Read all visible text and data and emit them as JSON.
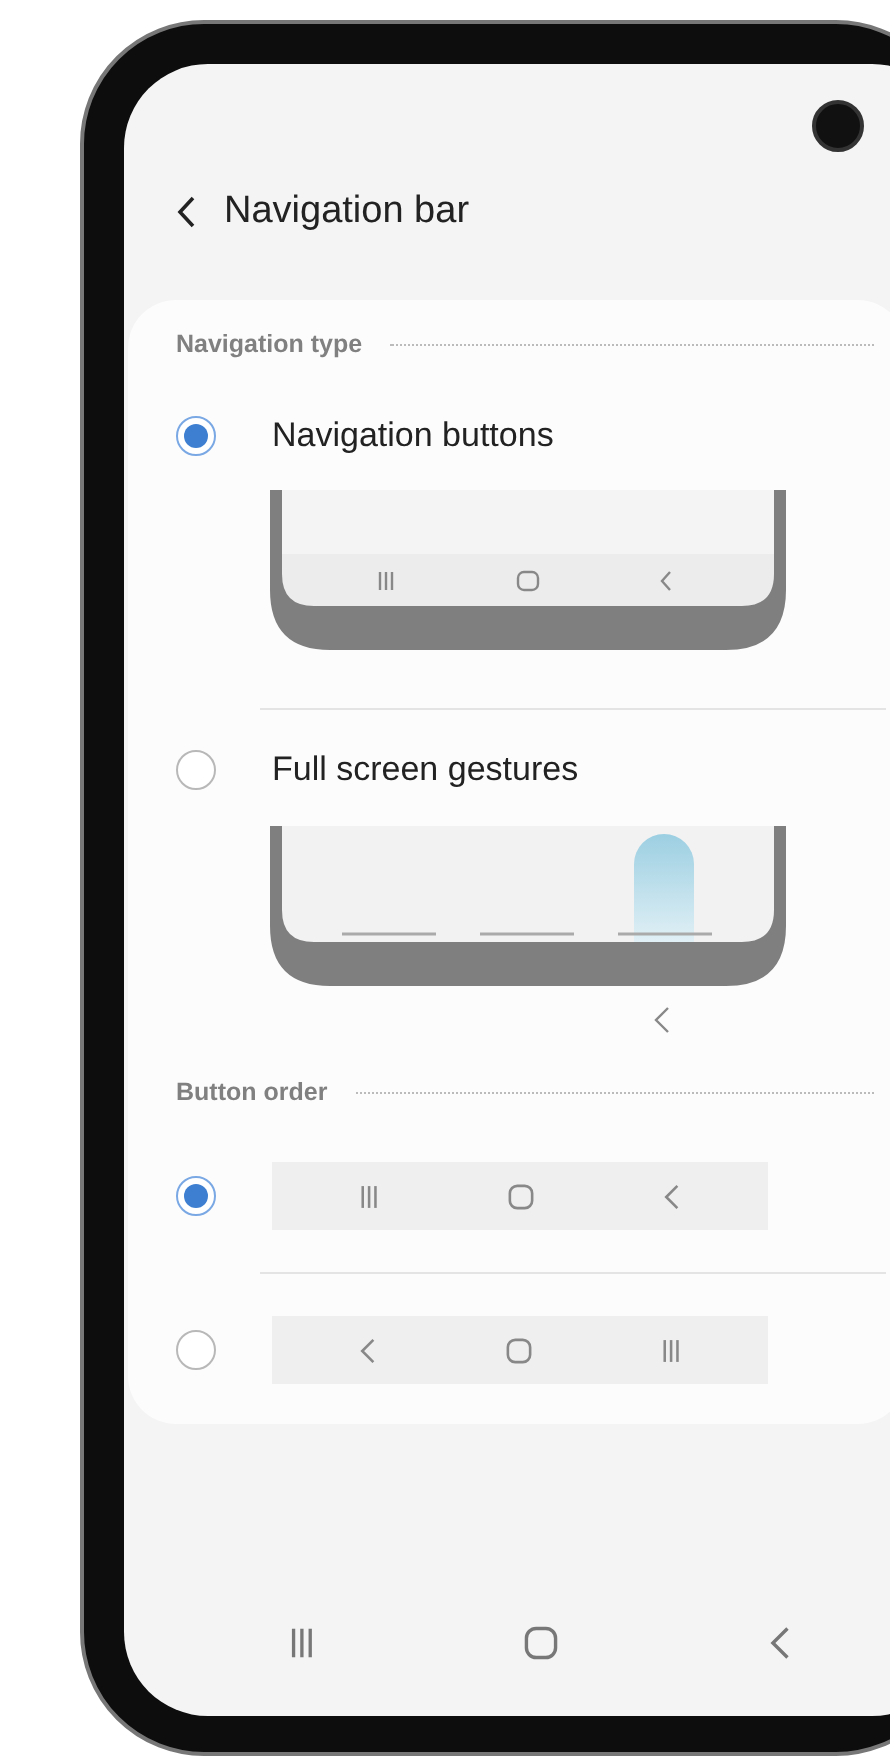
{
  "header": {
    "title": "Navigation bar"
  },
  "sections": [
    {
      "title": "Navigation type",
      "options": [
        {
          "kind": "buttons",
          "label": "Navigation buttons",
          "selected": true
        },
        {
          "kind": "gestures",
          "label": "Full screen gestures",
          "selected": false
        }
      ]
    },
    {
      "title": "Button order",
      "options": [
        {
          "kind": "order",
          "selected": true,
          "order": [
            {
              "kind": "recents"
            },
            {
              "kind": "home"
            },
            {
              "kind": "back"
            }
          ]
        },
        {
          "kind": "order",
          "selected": false,
          "order": [
            {
              "kind": "back"
            },
            {
              "kind": "home"
            },
            {
              "kind": "recents"
            }
          ]
        }
      ]
    }
  ],
  "system_nav": [
    {
      "kind": "recents"
    },
    {
      "kind": "home"
    },
    {
      "kind": "back"
    }
  ]
}
